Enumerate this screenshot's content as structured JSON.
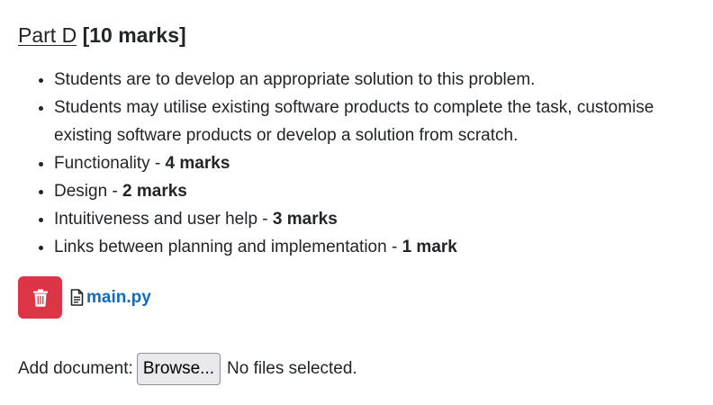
{
  "heading": {
    "part": "Part D",
    "marks": "[10 marks]"
  },
  "criteria": [
    {
      "text": "Students are to develop an appropriate solution to this problem.",
      "bold": ""
    },
    {
      "text": "Students may utilise existing software products to complete the task, customise existing software products or develop a solution from scratch.",
      "bold": ""
    },
    {
      "text": "Functionality - ",
      "bold": "4 marks"
    },
    {
      "text": "Design - ",
      "bold": "2 marks"
    },
    {
      "text": "Intuitiveness and user help - ",
      "bold": "3 marks"
    },
    {
      "text": "Links between planning and implementation - ",
      "bold": "1 mark"
    }
  ],
  "attachment": {
    "delete_icon": "trash-icon",
    "file_icon": "file-text-icon",
    "file_name": "main.py"
  },
  "upload": {
    "label": "Add document:",
    "browse_label": "Browse...",
    "status": "No files selected."
  },
  "colors": {
    "text": "#212529",
    "link": "#0f6cbf",
    "danger": "#dc3545",
    "button_bg": "#e9e9ed"
  }
}
